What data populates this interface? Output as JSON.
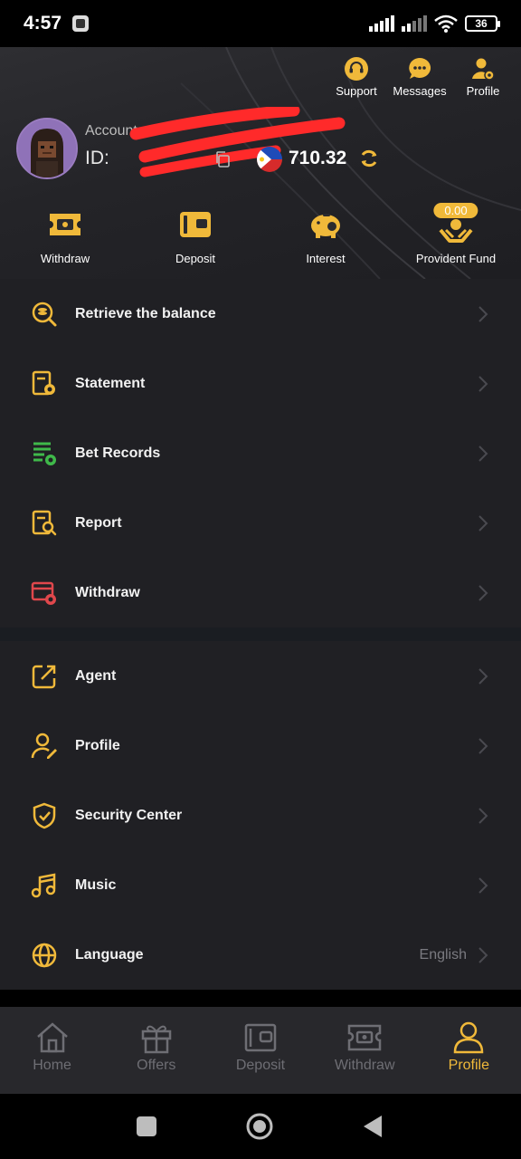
{
  "status_bar": {
    "time": "4:57",
    "battery": "36"
  },
  "top_actions": [
    {
      "label": "Support",
      "icon": "headset-icon"
    },
    {
      "label": "Messages",
      "icon": "chat-icon"
    },
    {
      "label": "Profile",
      "icon": "user-gear-icon"
    }
  ],
  "account": {
    "account_label": "Account:",
    "id_label": "ID:",
    "balance": "710.32",
    "currency_flag": "philippines-flag"
  },
  "quick_actions": [
    {
      "label": "Withdraw",
      "icon": "withdraw-ticket-icon"
    },
    {
      "label": "Deposit",
      "icon": "wallet-icon"
    },
    {
      "label": "Interest",
      "icon": "piggy-bank-icon"
    },
    {
      "label": "Provident Fund",
      "icon": "hands-coin-icon",
      "badge": "0.00"
    }
  ],
  "menu_group_1": [
    {
      "label": "Retrieve the balance",
      "icon": "coin-search-icon",
      "color": "#f0b93a"
    },
    {
      "label": "Statement",
      "icon": "statement-icon",
      "color": "#f0b93a"
    },
    {
      "label": "Bet Records",
      "icon": "bet-records-icon",
      "color": "#3fb94a"
    },
    {
      "label": "Report",
      "icon": "report-icon",
      "color": "#f0b93a"
    },
    {
      "label": "Withdraw",
      "icon": "withdraw-card-icon",
      "color": "#e0474c"
    }
  ],
  "menu_group_2": [
    {
      "label": "Agent",
      "icon": "share-icon",
      "color": "#f0b93a"
    },
    {
      "label": "Profile",
      "icon": "user-edit-icon",
      "color": "#f0b93a"
    },
    {
      "label": "Security Center",
      "icon": "shield-check-icon",
      "color": "#f0b93a"
    },
    {
      "label": "Music",
      "icon": "music-icon",
      "color": "#f0b93a"
    },
    {
      "label": "Language",
      "icon": "globe-icon",
      "color": "#f0b93a",
      "value": "English"
    }
  ],
  "bottom_nav": [
    {
      "label": "Home",
      "icon": "home-icon",
      "active": false
    },
    {
      "label": "Offers",
      "icon": "gift-icon",
      "active": false
    },
    {
      "label": "Deposit",
      "icon": "wallet-icon",
      "active": false
    },
    {
      "label": "Withdraw",
      "icon": "withdraw-ticket-icon",
      "active": false
    },
    {
      "label": "Profile",
      "icon": "person-icon",
      "active": true
    }
  ],
  "colors": {
    "accent": "#f0b93a",
    "background": "#202024",
    "header": "#2a2a2e"
  }
}
